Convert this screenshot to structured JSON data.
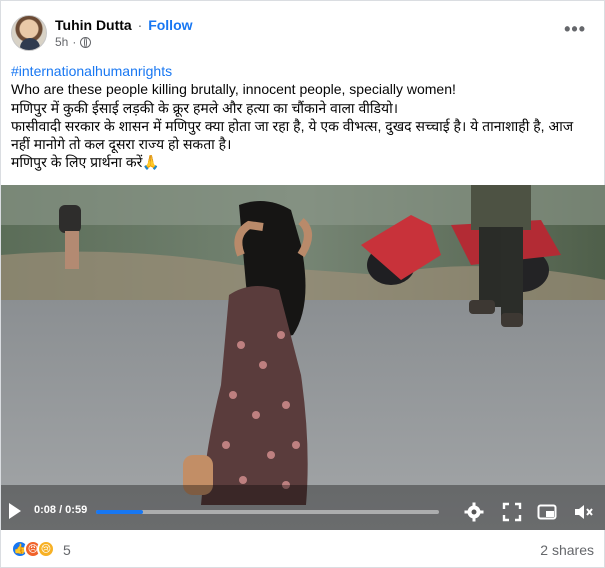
{
  "post": {
    "author": "Tuhin Dutta",
    "separator": "·",
    "follow_label": "Follow",
    "time": "5h",
    "more_label": "•••",
    "hashtag": "#internationalhumanrights",
    "lines": [
      "Who are these people killing brutally, innocent people, specially women!",
      "मणिपुर में कुकी ईसाई लड़की के क्रूर हमले और हत्या का चौंकाने वाला वीडियो।",
      "फासीवादी सरकार के शासन में मणिपुर क्या होता जा रहा है, ये एक वीभत्स, दुखद सच्चाई है। ये तानाशाही है, आज",
      "नहीं मानोगे तो कल दूसरा राज्य हो सकता है।",
      "मणिपुर के लिए प्रार्थना करें🙏"
    ]
  },
  "video": {
    "current_time": "0:08",
    "duration": "0:59",
    "time_display": "0:08 / 0:59",
    "progress_fraction": 0.136,
    "icons": [
      "play-icon",
      "settings-gear-icon",
      "fullscreen-icon",
      "picture-in-picture-icon",
      "volume-icon"
    ]
  },
  "footer": {
    "reaction_count": "5",
    "shares": "2 shares",
    "reactions": [
      "like",
      "angry",
      "sad"
    ]
  },
  "colors": {
    "accent": "#1877f2",
    "secondary_text": "#65676b"
  }
}
